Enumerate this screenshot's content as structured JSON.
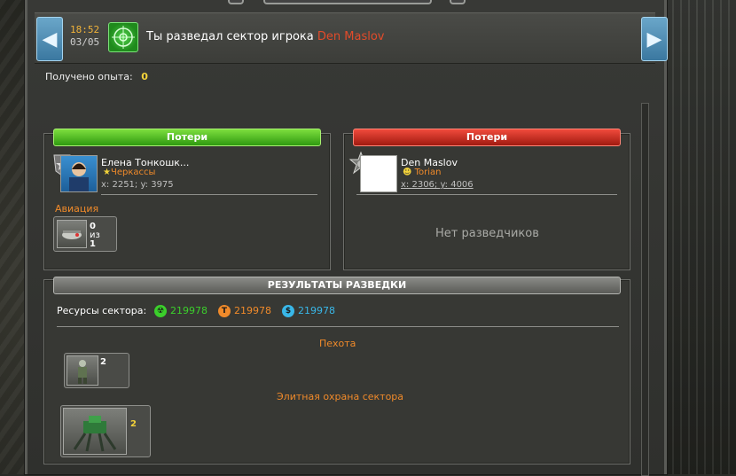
{
  "news": {
    "time": "18:52",
    "date": "03/05",
    "text": "Ты разведал сектор игрока",
    "player": "Den Maslov"
  },
  "experience": {
    "label": "Получено опыта:",
    "value": "0"
  },
  "left_panel": {
    "header": "Потери",
    "player_name": "Елена Тонкошк...",
    "city": "Черкассы",
    "coords": "x: 2251; y: 3975",
    "section": "Авиация",
    "unit": {
      "count": "0",
      "of_label": "из",
      "total": "1"
    }
  },
  "right_panel": {
    "header": "Потери",
    "player_name": "Den Maslov",
    "city": "Torian",
    "coords": "x: 2306; y: 4006",
    "empty_text": "Нет разведчиков"
  },
  "results": {
    "header": "РЕЗУЛЬТАТЫ РАЗВЕДКИ",
    "resources_label": "Ресурсы сектора:",
    "resources": [
      {
        "icon": "uranium-icon",
        "value": "219978",
        "color": "#3bd02b"
      },
      {
        "icon": "titanium-icon",
        "value": "219978",
        "color": "#f08a2a"
      },
      {
        "icon": "credits-icon",
        "value": "219978",
        "color": "#39b7e8"
      }
    ],
    "infantry_title": "Пехота",
    "infantry_count": "2",
    "elite_title": "Элитная охрана сектора",
    "elite_count": "2"
  }
}
